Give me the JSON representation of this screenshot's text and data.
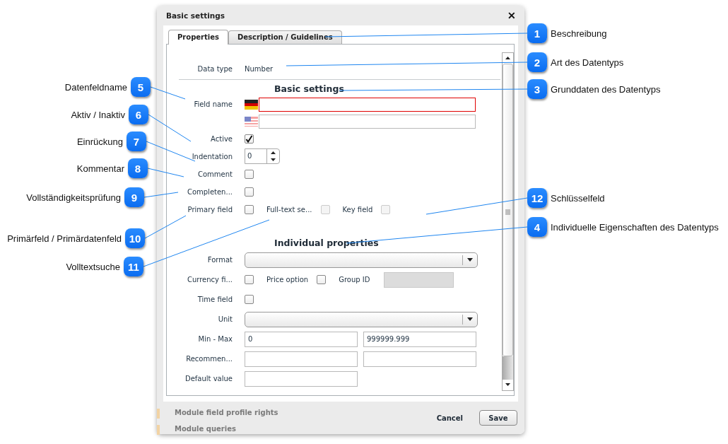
{
  "background_rows": [
    {
      "label": "Module field profile rights"
    },
    {
      "label": "Module queries"
    }
  ],
  "dialog": {
    "title": "Basic settings",
    "close": "✕",
    "tabs": [
      {
        "label": "Properties",
        "selected": true
      },
      {
        "label": "Description / Guidelines",
        "selected": false
      }
    ],
    "data_type": {
      "label": "Data type",
      "value": "Number"
    },
    "basic_heading": "Basic settings",
    "basic_rows": [
      {
        "kind": "localized",
        "label": "Field name",
        "inputs": [
          {
            "kind": "german",
            "invalid": true
          },
          {
            "kind": "american",
            "invalid": false
          }
        ]
      },
      {
        "kind": "checkbox",
        "label": "Active",
        "checked": true
      },
      {
        "kind": "spinner",
        "label": "Indentation",
        "value": "0"
      },
      {
        "kind": "checkbox",
        "label": "Comment",
        "checked": false
      },
      {
        "kind": "checkbox",
        "label": "Completen...",
        "checked": false
      },
      {
        "kind": "checks",
        "label": "Primary field",
        "checked": false,
        "extras": [
          {
            "label": "Full-text se...",
            "checked": false,
            "disabled": true
          },
          {
            "label": "Key field",
            "checked": false,
            "disabled": true
          }
        ]
      }
    ],
    "individual_heading": "Individual properties",
    "individual_rows": [
      {
        "kind": "select",
        "label": "Format"
      },
      {
        "kind": "checks",
        "label": "Currency fi...",
        "checked": false,
        "extras": [
          {
            "label": "Price option",
            "checked": false,
            "disabled": false
          }
        ],
        "field": {
          "label": "Group ID",
          "disabled": true
        }
      },
      {
        "kind": "checkbox",
        "label": "Time field",
        "checked": false
      },
      {
        "kind": "select",
        "label": "Unit"
      },
      {
        "kind": "inputs",
        "label": "Min - Max",
        "inputs": [
          {
            "value": "0"
          },
          {
            "value": "999999.999"
          }
        ]
      },
      {
        "kind": "blank-pair",
        "label": "Recommen..."
      },
      {
        "kind": "blank-input",
        "label": "Default value"
      }
    ],
    "buttons": [
      {
        "label": "Cancel",
        "kind": "link"
      },
      {
        "label": "Save",
        "kind": "button"
      }
    ]
  },
  "callouts": [
    {
      "number": "1",
      "label": "Beschreibung"
    },
    {
      "number": "2",
      "label": "Art des Datentyps"
    },
    {
      "number": "3",
      "label": "Grunddaten des Datentyps"
    },
    {
      "number": "12",
      "label": "Schlüsselfeld"
    },
    {
      "number": "4",
      "label": "Individuelle Eigenschaften des Datentyps"
    },
    {
      "number": "5",
      "label": "Datenfeldname"
    },
    {
      "number": "6",
      "label": "Aktiv / Inaktiv"
    },
    {
      "number": "7",
      "label": "Einrückung"
    },
    {
      "number": "8",
      "label": "Kommentar"
    },
    {
      "number": "9",
      "label": "Vollständigkeitsprüfung"
    },
    {
      "number": "10",
      "label": "Primärfeld / Primärdatenfeld"
    },
    {
      "number": "11",
      "label": "Volltextsuche"
    }
  ]
}
